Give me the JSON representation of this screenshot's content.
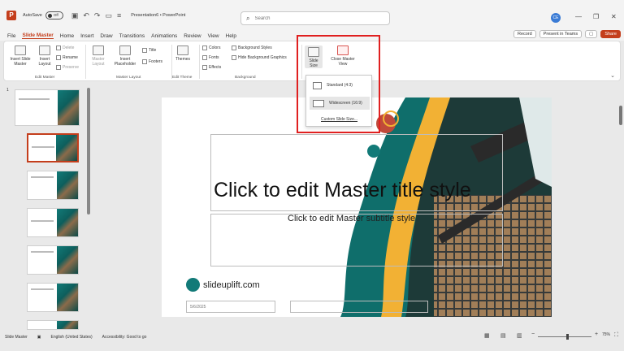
{
  "titlebar": {
    "autosave_label": "AutoSave",
    "autosave_state": "Off",
    "doc_title": "Presentation6 • PowerPoint",
    "avatar_initials": "CE"
  },
  "search": {
    "placeholder": "Search"
  },
  "menu": {
    "tabs": [
      "File",
      "Slide Master",
      "Home",
      "Insert",
      "Draw",
      "Transitions",
      "Animations",
      "Review",
      "View",
      "Help"
    ],
    "active": "Slide Master",
    "record": "Record",
    "present": "Present in Teams",
    "share": "Share"
  },
  "ribbon": {
    "insert_slide_master": "Insert Slide Master",
    "insert_layout": "Insert Layout",
    "delete": "Delete",
    "rename": "Rename",
    "preserve": "Preserve",
    "group_edit_master": "Edit Master",
    "master_layout": "Master Layout",
    "insert_placeholder": "Insert Placeholder",
    "title": "Title",
    "footers": "Footers",
    "group_master_layout": "Master Layout",
    "themes": "Themes",
    "group_edit_theme": "Edit Theme",
    "colors": "Colors",
    "fonts": "Fonts",
    "effects": "Effects",
    "background_styles": "Background Styles",
    "hide_background_graphics": "Hide Background Graphics",
    "group_background": "Background",
    "slide_size": "Slide Size",
    "close_master_view": "Close Master View"
  },
  "slide_size_menu": {
    "standard": "Standard (4:3)",
    "widescreen": "Widescreen (16:9)",
    "custom": "Custom Slide Size..."
  },
  "thumbnails": {
    "first_number": "1"
  },
  "slide": {
    "title": "Click to edit Master title style",
    "subtitle": "Click to edit Master subtitle style",
    "date": "5/6/2025",
    "brand": "slideuplift.com",
    "accent_color": "#127a78",
    "gold_color": "#f2b134"
  },
  "status": {
    "view": "Slide Master",
    "language": "English (United States)",
    "accessibility": "Accessibility: Good to go",
    "zoom": "75%"
  }
}
